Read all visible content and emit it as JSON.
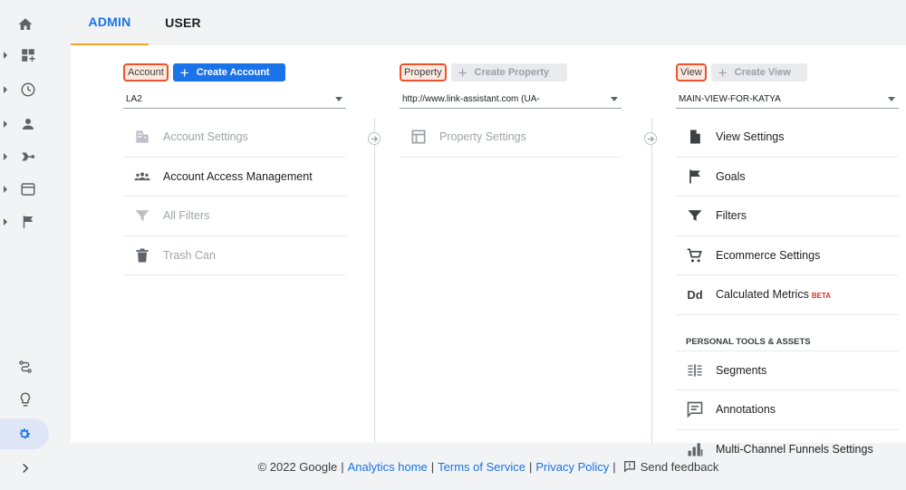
{
  "tabs": {
    "admin": "ADMIN",
    "user": "USER"
  },
  "account": {
    "label": "Account",
    "create": "Create Account",
    "selected": "LA2",
    "items": [
      {
        "label": "Account Settings",
        "icon": "building-icon",
        "enabled": false
      },
      {
        "label": "Account Access Management",
        "icon": "people-icon",
        "enabled": true
      },
      {
        "label": "All Filters",
        "icon": "filter-icon",
        "enabled": false
      },
      {
        "label": "Trash Can",
        "icon": "trash-icon",
        "enabled": false
      }
    ]
  },
  "property": {
    "label": "Property",
    "create": "Create Property",
    "selected": "http://www.link-assistant.com (UA-",
    "items": [
      {
        "label": "Property Settings",
        "icon": "layout-icon",
        "enabled": false
      }
    ]
  },
  "view": {
    "label": "View",
    "create": "Create View",
    "selected": "MAIN-VIEW-FOR-KATYA",
    "items": [
      {
        "label": "View Settings",
        "icon": "document-icon"
      },
      {
        "label": "Goals",
        "icon": "flag-icon"
      },
      {
        "label": "Filters",
        "icon": "filter-icon"
      },
      {
        "label": "Ecommerce Settings",
        "icon": "cart-icon"
      },
      {
        "label": "Calculated Metrics",
        "icon": "dd-icon",
        "badge": "BETA"
      }
    ],
    "section_title": "PERSONAL TOOLS & ASSETS",
    "tools": [
      {
        "label": "Segments",
        "icon": "segments-icon"
      },
      {
        "label": "Annotations",
        "icon": "comment-icon"
      },
      {
        "label": "Multi-Channel Funnels Settings",
        "icon": "bar-chart-icon"
      }
    ]
  },
  "footer": {
    "copyright": "© 2022 Google",
    "analytics_home": "Analytics home",
    "terms": "Terms of Service",
    "privacy": "Privacy Policy",
    "feedback": "Send feedback",
    "sep": "|"
  },
  "colors": {
    "accent": "#1a73e8",
    "highlight": "#e8542e",
    "tab_underline": "#f5a623"
  }
}
